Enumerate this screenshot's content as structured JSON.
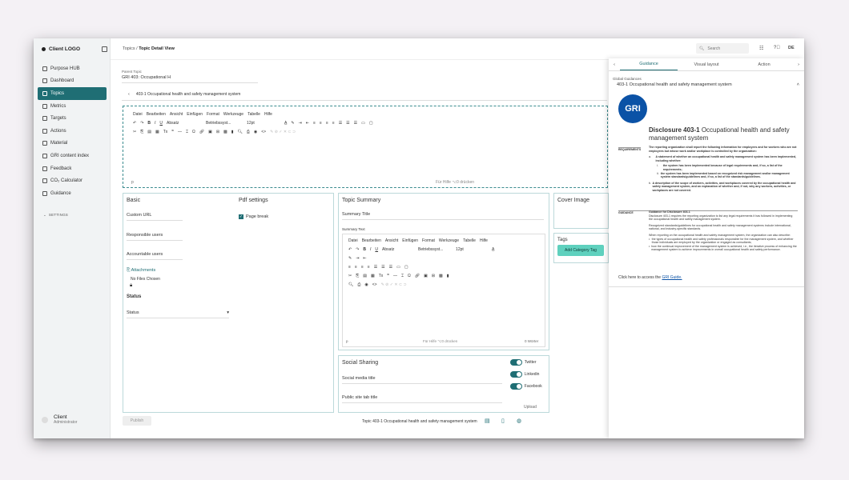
{
  "sidebar": {
    "logo": "Client LOGO",
    "items": [
      {
        "label": "Purpose HUB",
        "icon": "hub-icon"
      },
      {
        "label": "Dashboard",
        "icon": "dashboard-icon"
      },
      {
        "label": "Topics",
        "icon": "topics-icon",
        "active": true
      },
      {
        "label": "Metrics",
        "icon": "metrics-icon"
      },
      {
        "label": "Targets",
        "icon": "target-icon"
      },
      {
        "label": "Actions",
        "icon": "actions-icon"
      },
      {
        "label": "Material",
        "icon": "material-icon"
      },
      {
        "label": "GRI content index",
        "icon": "index-icon"
      },
      {
        "label": "Feedback",
        "icon": "feedback-icon"
      },
      {
        "label": "CO₂ Calculator",
        "icon": "calculator-icon"
      },
      {
        "label": "Guidance",
        "icon": "guidance-icon"
      }
    ],
    "settings": "SETTINGS",
    "user": {
      "name": "Client",
      "role": "Administrator"
    }
  },
  "topbar": {
    "breadcrumb_root": "Topics",
    "breadcrumb_sep": "/",
    "breadcrumb_current": "Topic Detail View",
    "search_placeholder": "Search",
    "lang": "DE"
  },
  "editor": {
    "parent_label": "Parent Topic",
    "parent_value": "GRI 403: Occupational H",
    "subtopic": "403-1 Occupational health and safety management system",
    "menu": [
      "Datei",
      "Bearbeiten",
      "Ansicht",
      "Einfügen",
      "Format",
      "Werkzeuge",
      "Tabelle",
      "Hilfe"
    ],
    "style_select": "Absatz",
    "font_select": "Betriebssyst...",
    "size_select": "12pt",
    "status_p": "p",
    "help": "Für Hilfe ⌥0 drücken"
  },
  "basic": {
    "title": "Basic",
    "custom_url": "Custom URL",
    "responsible": "Responsible users",
    "accountable": "Accountable users",
    "attachments": "Attachments",
    "no_files": "No Files Chosen",
    "status_title": "Status",
    "status_select": "Status"
  },
  "pdf": {
    "title": "Pdf settings",
    "page_break": "Page break"
  },
  "summary": {
    "title": "Topic Summary",
    "summary_title": "Summary Title",
    "summary_text": "Summary Text",
    "help": "Für Hilfe ⌥0 drücken",
    "words": "0 Wörter",
    "status_p": "p"
  },
  "cover": {
    "title": "Cover Image"
  },
  "tags": {
    "title": "Tags",
    "add_button": "Add Category Tag"
  },
  "social": {
    "title": "Social Sharing",
    "media_title": "Social media title",
    "public_title": "Public site tab title",
    "networks": [
      "Twitter",
      "Linkedin",
      "Facebook"
    ],
    "upload": "Upload"
  },
  "bottombar": {
    "publish": "Publish",
    "topic_prefix": "Topic",
    "topic_name": "403-1 Occupational health and safety management system"
  },
  "guidance": {
    "tabs": [
      "Guidance",
      "Visual layout",
      "Action"
    ],
    "section_label": "Global Guidances",
    "section_title": "403-1 Occupational health and safety management system",
    "logo_text": "GRI",
    "disclosure_bold": "Disclosure 403-1",
    "disclosure_rest": "Occupational health and safety management system",
    "requirements_label": "REQUIREMENTS",
    "requirements_intro": "The reporting organization shall report the following information for employees and for workers who are not employees but whose work and/or workplace is controlled by the organization:",
    "req_a": "A statement of whether an occupational health and safety management system has been implemented, including whether:",
    "req_a_i": "the system has been implemented because of legal requirements and, if so, a list of the requirements;",
    "req_a_ii": "the system has been implemented based on recognized risk management and/or management system standards/guidelines and, if so, a list of the standards/guidelines.",
    "req_b": "A description of the scope of workers, activities, and workplaces covered by the occupational health and safety management system, and an explanation of whether and, if not, why any workers, activities, or workplaces are not covered.",
    "guidance_label": "GUIDANCE",
    "guidance_title": "Guidance for Disclosure 403-1",
    "guidance_p1": "Disclosure 403-1 requires the reporting organization to list any legal requirements it has followed in implementing the occupational health and safety management system.",
    "guidance_p2": "Recognized standards/guidelines for occupational health and safety management systems include international, national, and industry-specific standards.",
    "guidance_p3": "When reporting on the occupational health and safety management system, the organization can also describe:",
    "bullet1": "the types of occupational health and safety professionals responsible for the management system, and whether those individuals are employed by the organization or engaged as consultants;",
    "bullet2": "how the continual improvement of the management system is achieved, i.e., the iterative process of enhancing the management system to achieve improvements in overall occupational health and safety performance.",
    "footer_prefix": "Click here to access the",
    "footer_link": "GRI Guide."
  }
}
